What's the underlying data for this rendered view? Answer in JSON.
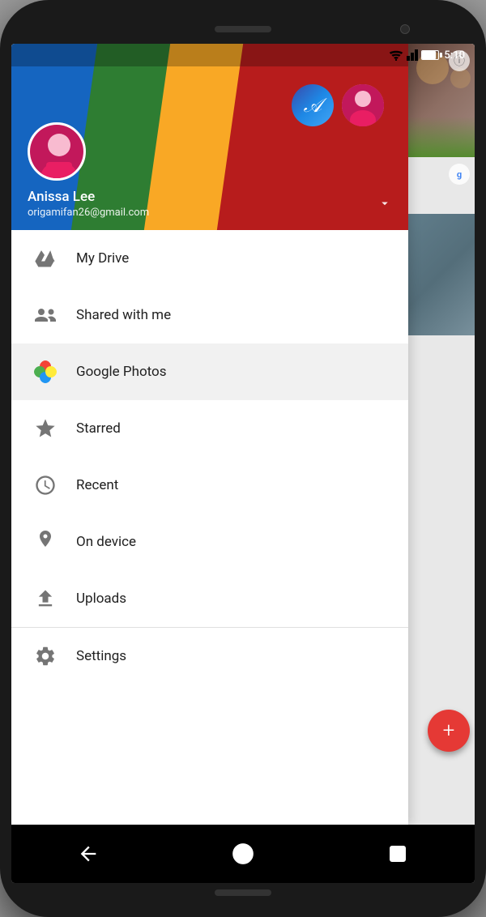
{
  "phone": {
    "status": {
      "time": "5:10"
    }
  },
  "user": {
    "name": "Anissa Lee",
    "email": "origamifan26@gmail.com",
    "avatar_letter": "A",
    "avatar_alt": "User photo"
  },
  "menu": {
    "items": [
      {
        "id": "my-drive",
        "label": "My Drive",
        "icon": "drive",
        "active": false
      },
      {
        "id": "shared-with-me",
        "label": "Shared with me",
        "icon": "people",
        "active": false
      },
      {
        "id": "google-photos",
        "label": "Google Photos",
        "icon": "pinwheel",
        "active": true
      },
      {
        "id": "starred",
        "label": "Starred",
        "icon": "star",
        "active": false
      },
      {
        "id": "recent",
        "label": "Recent",
        "icon": "clock",
        "active": false
      },
      {
        "id": "on-device",
        "label": "On device",
        "icon": "pin",
        "active": false
      },
      {
        "id": "uploads",
        "label": "Uploads",
        "icon": "upload",
        "active": false
      }
    ],
    "settings": {
      "label": "Settings",
      "icon": "gear"
    }
  },
  "nav": {
    "back": "◁",
    "home": "○",
    "recent": "□"
  }
}
